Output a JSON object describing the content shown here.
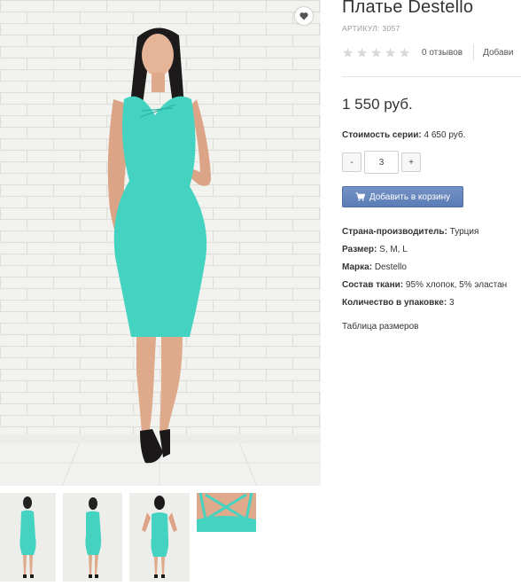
{
  "product": {
    "title": "Платье Destello",
    "sku": "АРТИКУЛ: 3057",
    "rating": 0,
    "rating_max": 5,
    "reviews": "0 отзывов",
    "add_review": "Добави",
    "price": "1 550 руб.",
    "series_label": "Стоимость серии:",
    "series_value": "4 650 руб.",
    "quantity": "3",
    "qty_minus": "-",
    "qty_plus": "+",
    "add_to_cart": "Добавить в корзину",
    "size_table_link": "Таблица размеров"
  },
  "specs": [
    {
      "label": "Страна-производитель:",
      "value": "Турция"
    },
    {
      "label": "Размер:",
      "value": "S, M, L"
    },
    {
      "label": "Марка:",
      "value": "Destello"
    },
    {
      "label": "Состав ткани:",
      "value": "95% хлопок, 5% эластан"
    },
    {
      "label": "Количество в упаковке:",
      "value": "3"
    }
  ],
  "icons": {
    "favorite": "heart-icon",
    "star": "star-icon",
    "cart": "cart-icon"
  },
  "colors": {
    "dress": "#45d3c1",
    "button": "#6686bd",
    "star_empty": "#d9d9d9"
  },
  "gallery": {
    "thumbnails": [
      {
        "view": "front-full"
      },
      {
        "view": "front-full-side"
      },
      {
        "view": "back-full"
      },
      {
        "view": "back-detail"
      }
    ]
  }
}
